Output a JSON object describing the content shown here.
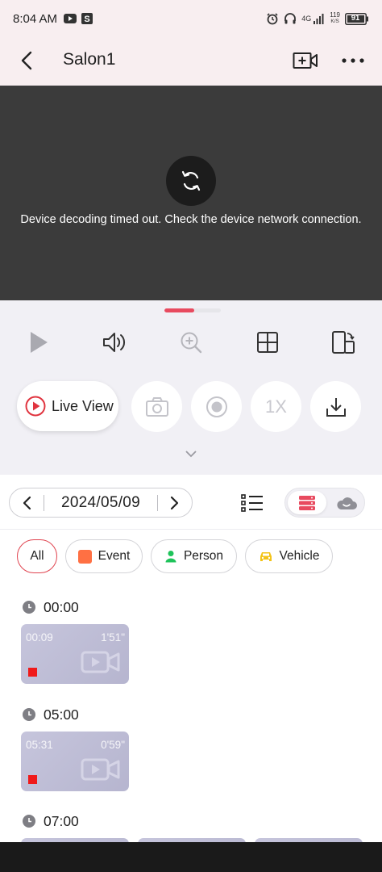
{
  "status_bar": {
    "time": "8:04 AM",
    "network_label": "4G",
    "speed_value": "119",
    "speed_unit": "K/S",
    "battery": "91"
  },
  "header": {
    "title": "Salon1"
  },
  "video": {
    "error_message": "Device decoding timed out. Check the device network connection."
  },
  "actions": {
    "live_view_label": "Live View",
    "speed_label": "1X"
  },
  "date_bar": {
    "date": "2024/05/09"
  },
  "filters": {
    "all": "All",
    "event": "Event",
    "person": "Person",
    "vehicle": "Vehicle",
    "event_color": "#ff7043",
    "person_color": "#1ec35a",
    "vehicle_color": "#f3c316"
  },
  "timeline": {
    "groups": [
      {
        "time": "00:00",
        "clips": [
          {
            "start": "00:09",
            "duration": "1'51\""
          }
        ]
      },
      {
        "time": "05:00",
        "clips": [
          {
            "start": "05:31",
            "duration": "0'59\""
          }
        ]
      },
      {
        "time": "07:00",
        "clips": []
      }
    ]
  },
  "colors": {
    "accent": "#e84a5f",
    "video_bg": "#3b3b3b",
    "panel_bg": "#f1f0f5",
    "record_mark": "#f01a1a"
  }
}
